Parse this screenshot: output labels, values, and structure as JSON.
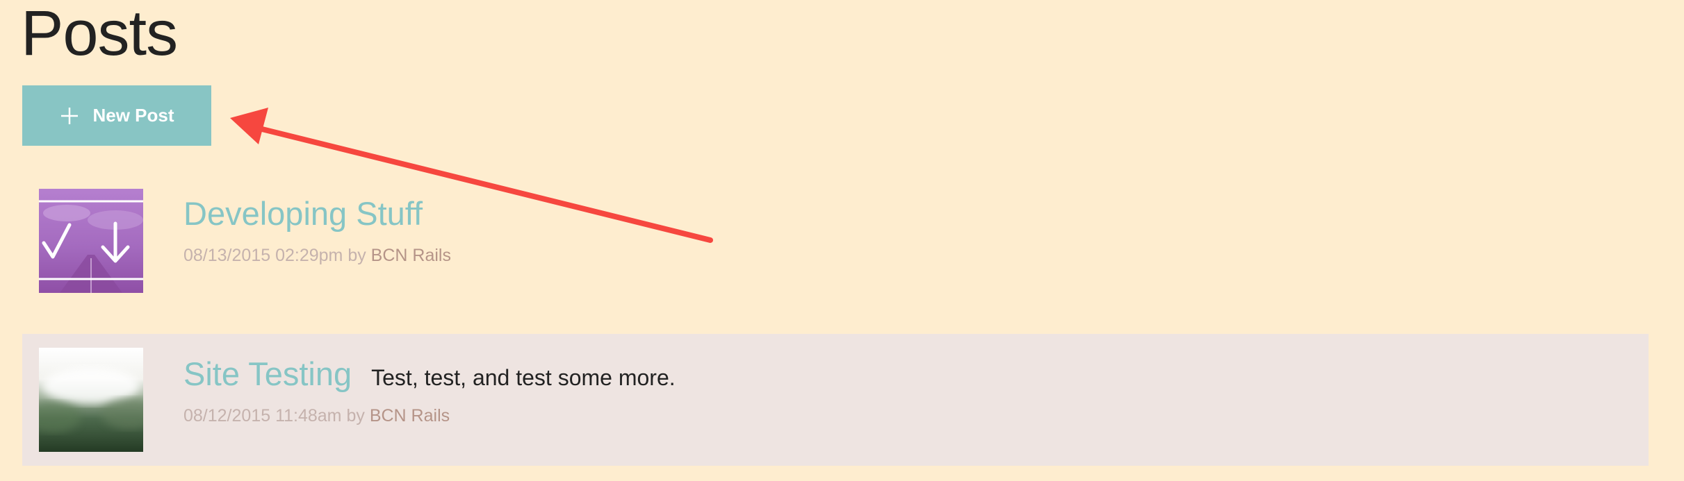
{
  "page": {
    "title": "Posts"
  },
  "toolbar": {
    "new_post_label": "New Post",
    "new_post_icon": "plus-icon"
  },
  "posts": [
    {
      "title": "Developing Stuff",
      "excerpt": "",
      "date": "08/13/2015 02:29pm",
      "by_label": "by",
      "author": "BCN Rails",
      "thumbnail": "check-download-thumbnail"
    },
    {
      "title": "Site Testing",
      "excerpt": "Test, test, and test some more.",
      "date": "08/12/2015 11:48am",
      "by_label": "by",
      "author": "BCN Rails",
      "thumbnail": "blurred-landscape-thumbnail"
    }
  ],
  "colors": {
    "background": "#feedcf",
    "button": "#88c5c4",
    "link": "#86c5c5",
    "annotation_arrow": "#f6473f",
    "highlight_row": "#eee4e1"
  }
}
